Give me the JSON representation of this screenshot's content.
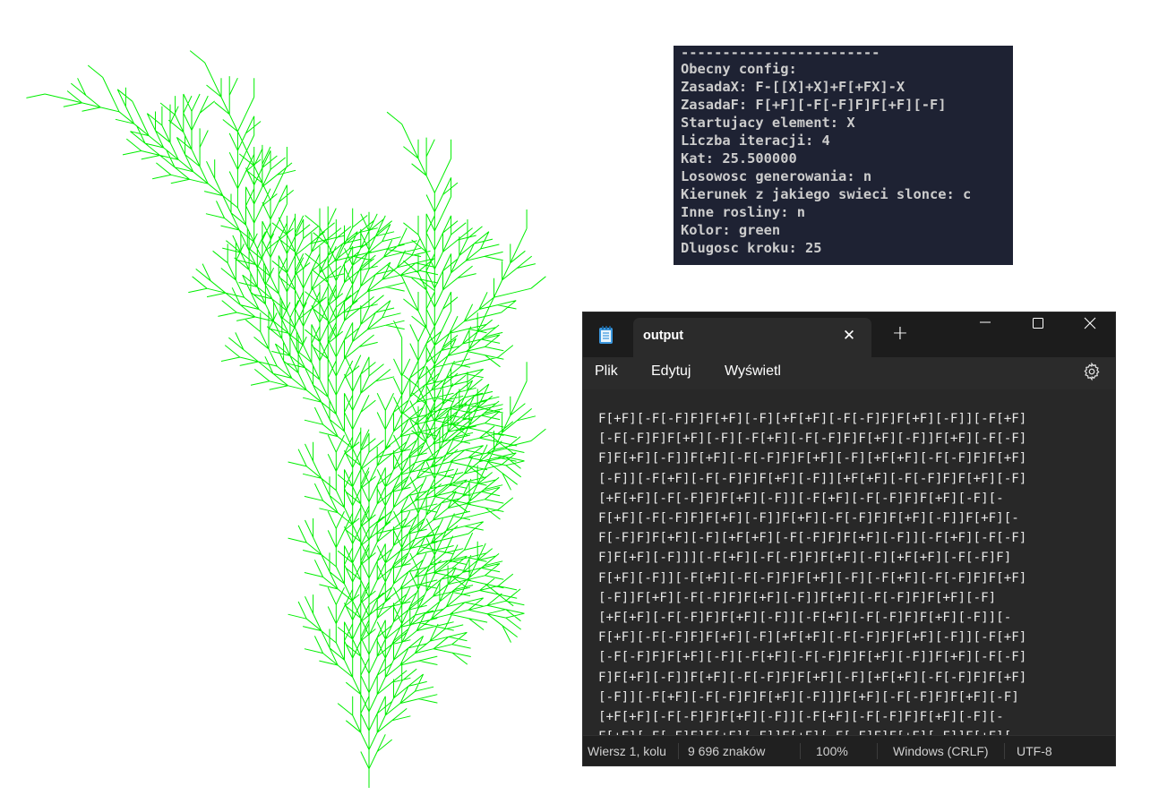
{
  "plant": {
    "color": "#00ee00",
    "angle_deg": 25.5,
    "iterations": 4,
    "rule_x": "F-[[X]+X]+F[+FX]-X",
    "rule_f": "F[+F][-F[-F]F]F[+F][-F]",
    "axiom": "X"
  },
  "console": {
    "separator": "------------------------",
    "lines": [
      "Obecny config:",
      "ZasadaX: F-[[X]+X]+F[+FX]-X",
      "ZasadaF: F[+F][-F[-F]F]F[+F][-F]",
      "Startujacy element: X",
      "Liczba iteracji: 4",
      "Kat: 25.500000",
      "Losowosc generowania: n",
      "Kierunek z jakiego swieci slonce: c",
      "Inne rosliny: n",
      "Kolor: green",
      "Dlugosc kroku: 25"
    ]
  },
  "notepad": {
    "tab_title": "output",
    "menu": {
      "file": "Plik",
      "edit": "Edytuj",
      "view": "Wyświetl"
    },
    "content_lines": [
      "F[+F][-F[-F]F]F[+F][-F][+F[+F][-F[-F]F]F[+F][-F]][-F[+F]",
      "[-F[-F]F]F[+F][-F][-F[+F][-F[-F]F]F[+F][-F]]F[+F][-F[-F]",
      "F]F[+F][-F]]F[+F][-F[-F]F]F[+F][-F][+F[+F][-F[-F]F]F[+F]",
      "[-F]][-F[+F][-F[-F]F]F[+F][-F]][+F[+F][-F[-F]F]F[+F][-F]",
      "[+F[+F][-F[-F]F]F[+F][-F]][-F[+F][-F[-F]F]F[+F][-F][-",
      "F[+F][-F[-F]F]F[+F][-F]]F[+F][-F[-F]F]F[+F][-F]]F[+F][-",
      "F[-F]F]F[+F][-F][+F[+F][-F[-F]F]F[+F][-F]][-F[+F][-F[-F]",
      "F]F[+F][-F]]][-F[+F][-F[-F]F]F[+F][-F][+F[+F][-F[-F]F]",
      "F[+F][-F]][-F[+F][-F[-F]F]F[+F][-F][-F[+F][-F[-F]F]F[+F]",
      "[-F]]F[+F][-F[-F]F]F[+F][-F]]F[+F][-F[-F]F]F[+F][-F]",
      "[+F[+F][-F[-F]F]F[+F][-F]][-F[+F][-F[-F]F]F[+F][-F]][-",
      "F[+F][-F[-F]F]F[+F][-F][+F[+F][-F[-F]F]F[+F][-F]][-F[+F]",
      "[-F[-F]F]F[+F][-F][-F[+F][-F[-F]F]F[+F][-F]]F[+F][-F[-F]",
      "F]F[+F][-F]]F[+F][-F[-F]F]F[+F][-F][+F[+F][-F[-F]F]F[+F]",
      "[-F]][-F[+F][-F[-F]F]F[+F][-F]]]F[+F][-F[-F]F]F[+F][-F]",
      "[+F[+F][-F[-F]F]F[+F][-F]][-F[+F][-F[-F]F]F[+F][-F][-",
      "F[+F][-F[-F]F]F[+F][-F]]F[+F][-F[-F]F]F[+F][-F]]F[+F][-"
    ],
    "status": {
      "position": "Wiersz 1, kolu",
      "chars": "9 696 znaków",
      "zoom": "100%",
      "line_endings": "Windows (CRLF)",
      "encoding": "UTF-8"
    }
  }
}
